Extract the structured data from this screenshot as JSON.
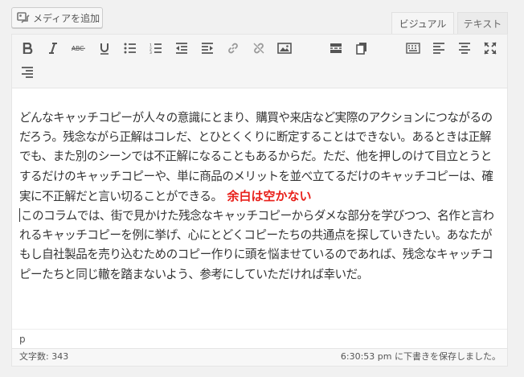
{
  "media": {
    "add_label": "メディアを追加"
  },
  "tabs": {
    "visual": "ビジュアル",
    "text": "テキスト"
  },
  "toolbar": {
    "buttons": [
      "bold-icon",
      "italic-icon",
      "strikethrough-icon",
      "underline-icon",
      "bullet-list-icon",
      "numbered-list-icon",
      "outdent-icon",
      "indent-icon",
      "link-icon",
      "unlink-icon",
      "image-icon",
      "insert-more-icon",
      "paste-word-icon",
      "toolbar-toggle-icon",
      "align-left-icon",
      "align-center-icon",
      "fullscreen-icon",
      "align-right-icon"
    ]
  },
  "content": {
    "paragraph1": "どんなキャッチコピーが人々の意識にとまり、購買や来店など実際のアクションにつながるのだろう。残念ながら正解はコレだ、とひとくくりに断定することはできない。あるときは正解でも、また別のシーンでは不正解になることもあるからだ。ただ、他を押しのけて目立とうとするだけのキャッチコピーや、単に商品のメリットを並べ立てるだけのキャッチコピーは、確実に不正解だと言い切ることができる。",
    "annotation": "余白は空かない",
    "annotation_color": "#e8201a",
    "paragraph2": "このコラムでは、街で見かけた残念なキャッチコピーからダメな部分を学びつつ、名作と言われるキャッチコピーを例に挙げ、心にとどくコピーたちの共通点を探していきたい。あなたがもし自社製品を売り込むためのコピー作りに頭を悩ませているのであれば、残念なキャッチコピーたちと同じ轍を踏まないよう、参考にしていただければ幸いだ。"
  },
  "path": {
    "element": "p"
  },
  "status": {
    "word_count": "文字数: 343",
    "saved": "6:30:53 pm に下書きを保存しました。"
  }
}
